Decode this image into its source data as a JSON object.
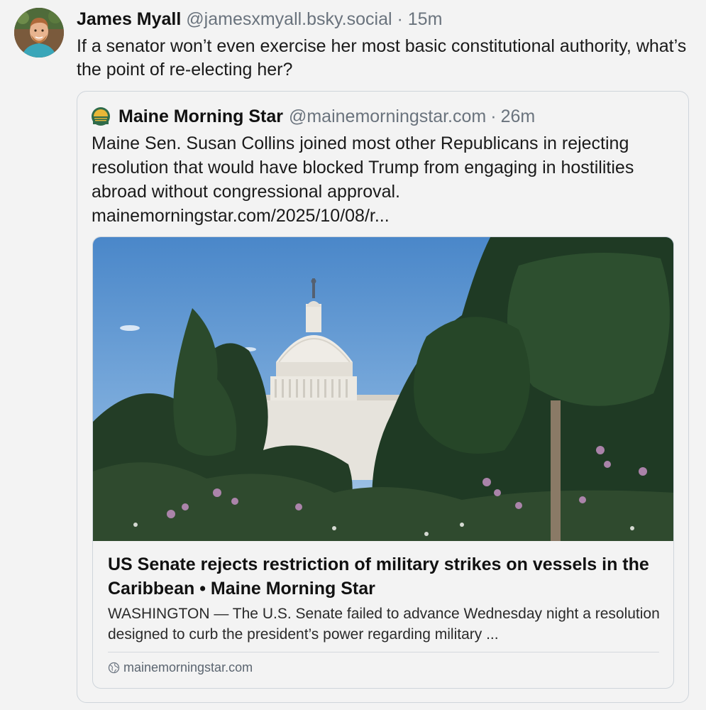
{
  "post": {
    "author_name": "James Myall",
    "handle": "@jamesxmyall.bsky.social",
    "separator": "·",
    "time": "15m",
    "text": "If a senator won’t even exercise her most basic constitutional authority, what’s the point of re-electing her?",
    "avatar_icon": "user-avatar-photo"
  },
  "quote": {
    "author_name": "Maine Morning Star",
    "handle": "@mainemorningstar.com",
    "separator": "·",
    "time": "26m",
    "text": "Maine Sen. Susan Collins joined most other Republicans in rejecting resolution that would have blocked Trump from engaging in hostilities abroad without congressional approval.",
    "link": "mainemorningstar.com/2025/10/08/r...",
    "avatar_icon": "sun-logo-icon"
  },
  "card": {
    "image_description": "capitol-dome-photo",
    "title": "US Senate rejects restriction of military strikes on vessels in the Caribbean • Maine Morning Star",
    "description": "WASHINGTON — The U.S. Senate failed to advance Wednesday night a resolution designed to curb the president’s power regarding military ...",
    "domain": "mainemorningstar.com",
    "domain_icon": "globe-icon"
  },
  "colors": {
    "background": "#f3f3f3",
    "border": "#cfd5db",
    "muted_text": "#6a737d",
    "logo_green": "#2f6b4a",
    "logo_gold": "#e8b737"
  }
}
